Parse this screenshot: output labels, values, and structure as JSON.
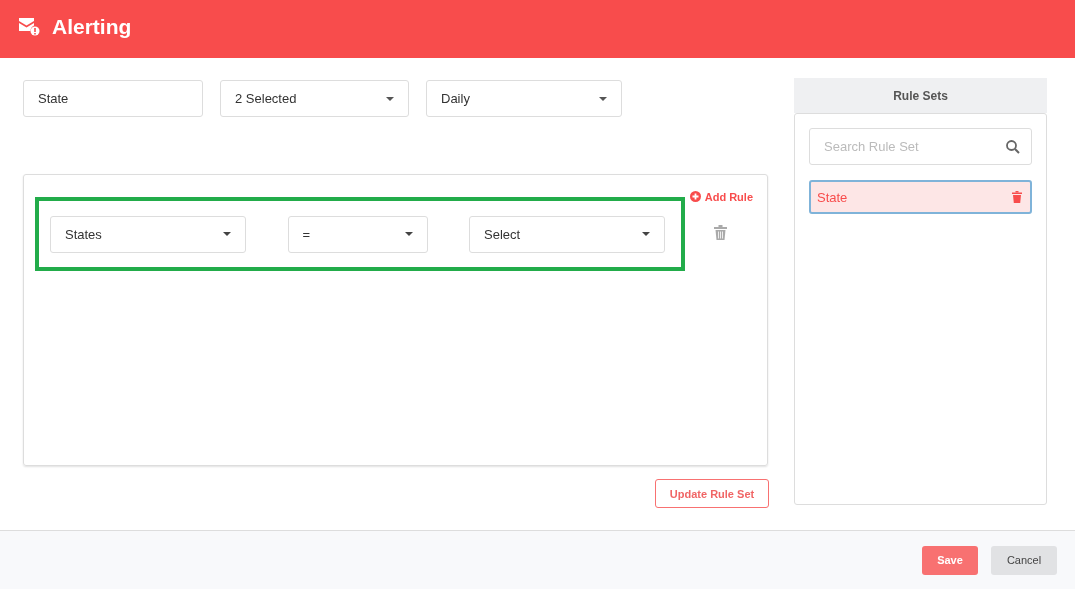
{
  "header": {
    "title": "Alerting"
  },
  "filters": [
    {
      "kind": "input",
      "value": "State"
    },
    {
      "kind": "dropdown",
      "value": "2 Selected"
    },
    {
      "kind": "dropdown",
      "value": "Daily"
    }
  ],
  "rules": {
    "add_label": "Add Rule",
    "items": [
      {
        "field": "States",
        "operator": "=",
        "value": "Select",
        "highlighted": true
      }
    ]
  },
  "update_button": "Update Rule Set",
  "rule_sets": {
    "title": "Rule Sets",
    "search": {
      "placeholder": "Search Rule Set"
    },
    "items": [
      {
        "label": "State",
        "selected": true
      }
    ]
  },
  "footer": {
    "buttons": [
      {
        "label": "Save",
        "kind": "primary"
      },
      {
        "label": "Cancel",
        "kind": "secondary"
      }
    ]
  }
}
